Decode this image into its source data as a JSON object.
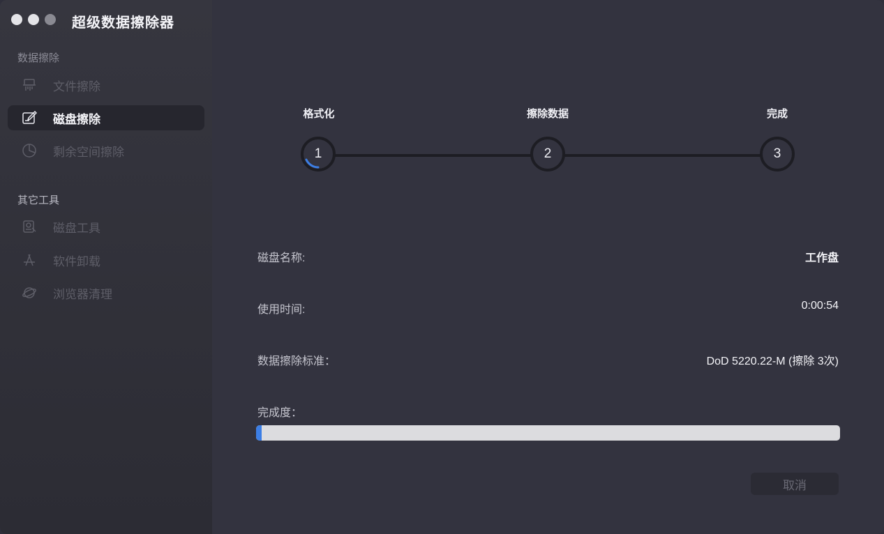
{
  "app": {
    "title": "超级数据擦除器"
  },
  "sidebar": {
    "section_erase": "数据擦除",
    "items_erase": [
      {
        "label": "文件擦除",
        "icon": "shredder-icon",
        "active": false
      },
      {
        "label": "磁盘擦除",
        "icon": "disk-edit-icon",
        "active": true
      },
      {
        "label": "剩余空间擦除",
        "icon": "pie-chart-icon",
        "active": false
      }
    ],
    "section_tools": "其它工具",
    "items_tools": [
      {
        "label": "磁盘工具",
        "icon": "disk-tool-icon",
        "active": false
      },
      {
        "label": "软件卸载",
        "icon": "app-uninstall-icon",
        "active": false
      },
      {
        "label": "浏览器清理",
        "icon": "planet-icon",
        "active": false
      }
    ]
  },
  "steps": [
    {
      "label": "格式化",
      "number": "1"
    },
    {
      "label": "擦除数据",
      "number": "2"
    },
    {
      "label": "完成",
      "number": "3"
    }
  ],
  "info": {
    "disk_name_label": "磁盘名称:",
    "disk_name_value": "工作盘",
    "time_label": "使用时间:",
    "time_value": "0:00:54",
    "standard_label": "数据擦除标准：",
    "standard_value": "DoD 5220.22-M (擦除 3次)",
    "progress_label": "完成度：",
    "progress_fraction": 0.01
  },
  "buttons": {
    "cancel": "取消"
  },
  "colors": {
    "close": "#e4e4e8",
    "minimize": "#e4e4e8",
    "zoom": "#8a8a92",
    "accent": "#3c7ee5"
  }
}
